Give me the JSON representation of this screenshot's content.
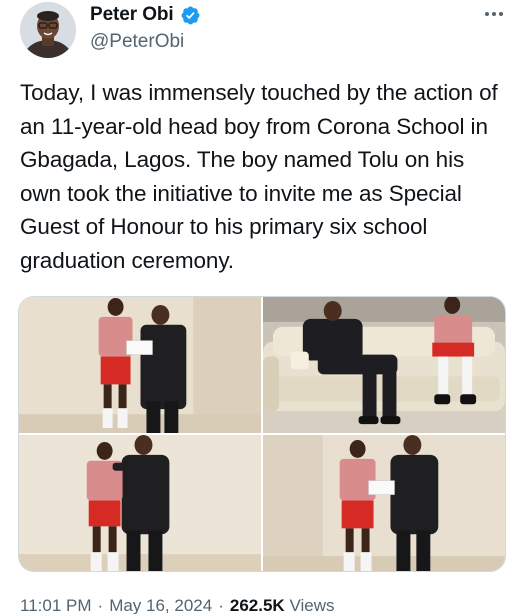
{
  "author": {
    "display_name": "Peter Obi",
    "handle": "@PeterObi",
    "verified_icon": "verified-badge-icon",
    "accent_color": "#1d9bf0"
  },
  "menu": {
    "icon": "more-horizontal-icon"
  },
  "tweet": {
    "text": "Today, I was immensely touched by the action of an 11-year-old head boy from Corona School in Gbagada, Lagos. The boy named Tolu on his own took the initiative to invite me as Special Guest of Honour to his primary six school graduation ceremony."
  },
  "meta": {
    "time": "11:01 PM",
    "date": "May 16, 2024",
    "separator": "·",
    "views_count": "262.5K",
    "views_label": "Views"
  }
}
